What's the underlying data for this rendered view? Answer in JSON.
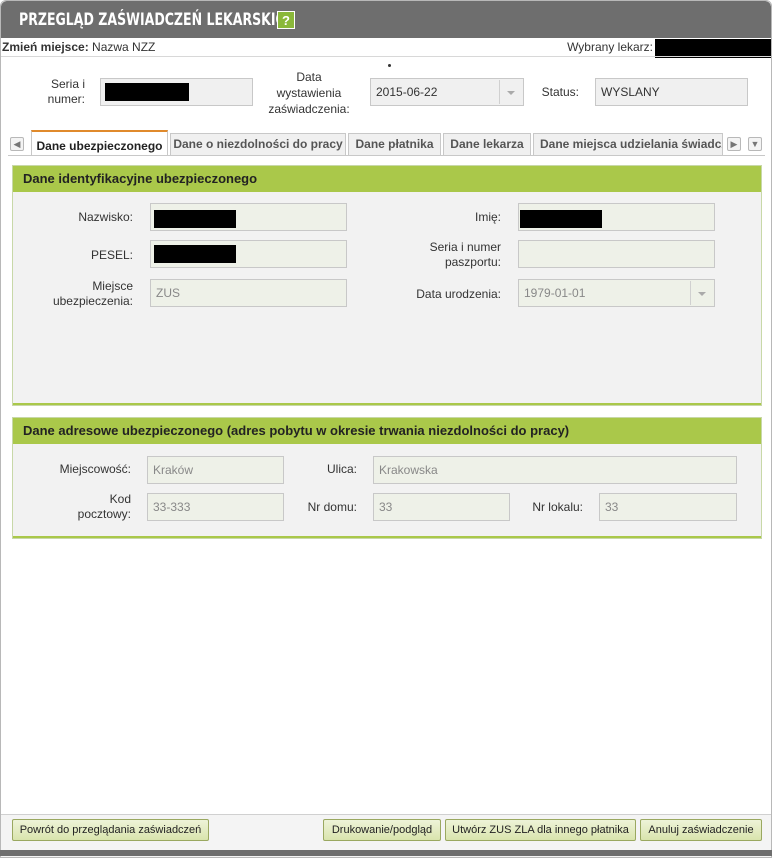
{
  "header": {
    "title": "PRZEGLĄD ZAŚWIADCZEŃ LEKARSKICH",
    "help_label": "?"
  },
  "infobar": {
    "change_place_label": "Zmień miejsce:",
    "place_value": "Nazwa NZZ",
    "doctor_label": "Wybrany lekarz:"
  },
  "certificate": {
    "series_label": "Seria i numer:",
    "issue_date_label": "Data wystawienia zaświadczenia:",
    "issue_date_value": "2015-06-22",
    "status_label": "Status:",
    "status_value": "WYSLANY"
  },
  "tabs": [
    {
      "label": "Dane ubezpieczonego"
    },
    {
      "label": "Dane o niezdolności do pracy"
    },
    {
      "label": "Dane płatnika"
    },
    {
      "label": "Dane lekarza"
    },
    {
      "label": "Dane miejsca udzielania świadcz"
    }
  ],
  "insured_panel": {
    "title": "Dane identyfikacyjne ubezpieczonego",
    "surname_label": "Nazwisko:",
    "first_name_label": "Imię:",
    "pesel_label": "PESEL:",
    "passport_label": "Seria i numer paszportu:",
    "insurance_place_label": "Miejsce ubezpieczenia:",
    "insurance_place_value": "ZUS",
    "birth_date_label": "Data urodzenia:",
    "birth_date_value": "1979-01-01"
  },
  "address_panel": {
    "title": "Dane adresowe ubezpieczonego (adres pobytu w okresie trwania niezdolności do pracy)",
    "city_label": "Miejscowość:",
    "city_value": "Kraków",
    "street_label": "Ulica:",
    "street_value": "Krakowska",
    "postal_label": "Kod pocztowy:",
    "postal_value": "33-333",
    "house_label": "Nr domu:",
    "house_value": "33",
    "flat_label": "Nr lokalu:",
    "flat_value": "33"
  },
  "buttons": {
    "back": "Powrót do przeglądania zaświadczeń",
    "print": "Drukowanie/podgląd",
    "create": "Utwórz ZUS ZLA dla innego płatnika",
    "cancel": "Anuluj zaświadczenie"
  },
  "colors": {
    "title_bar": "#6e6e6e",
    "panel_header": "#aac84a",
    "active_tab_accent": "#e08a2c"
  }
}
